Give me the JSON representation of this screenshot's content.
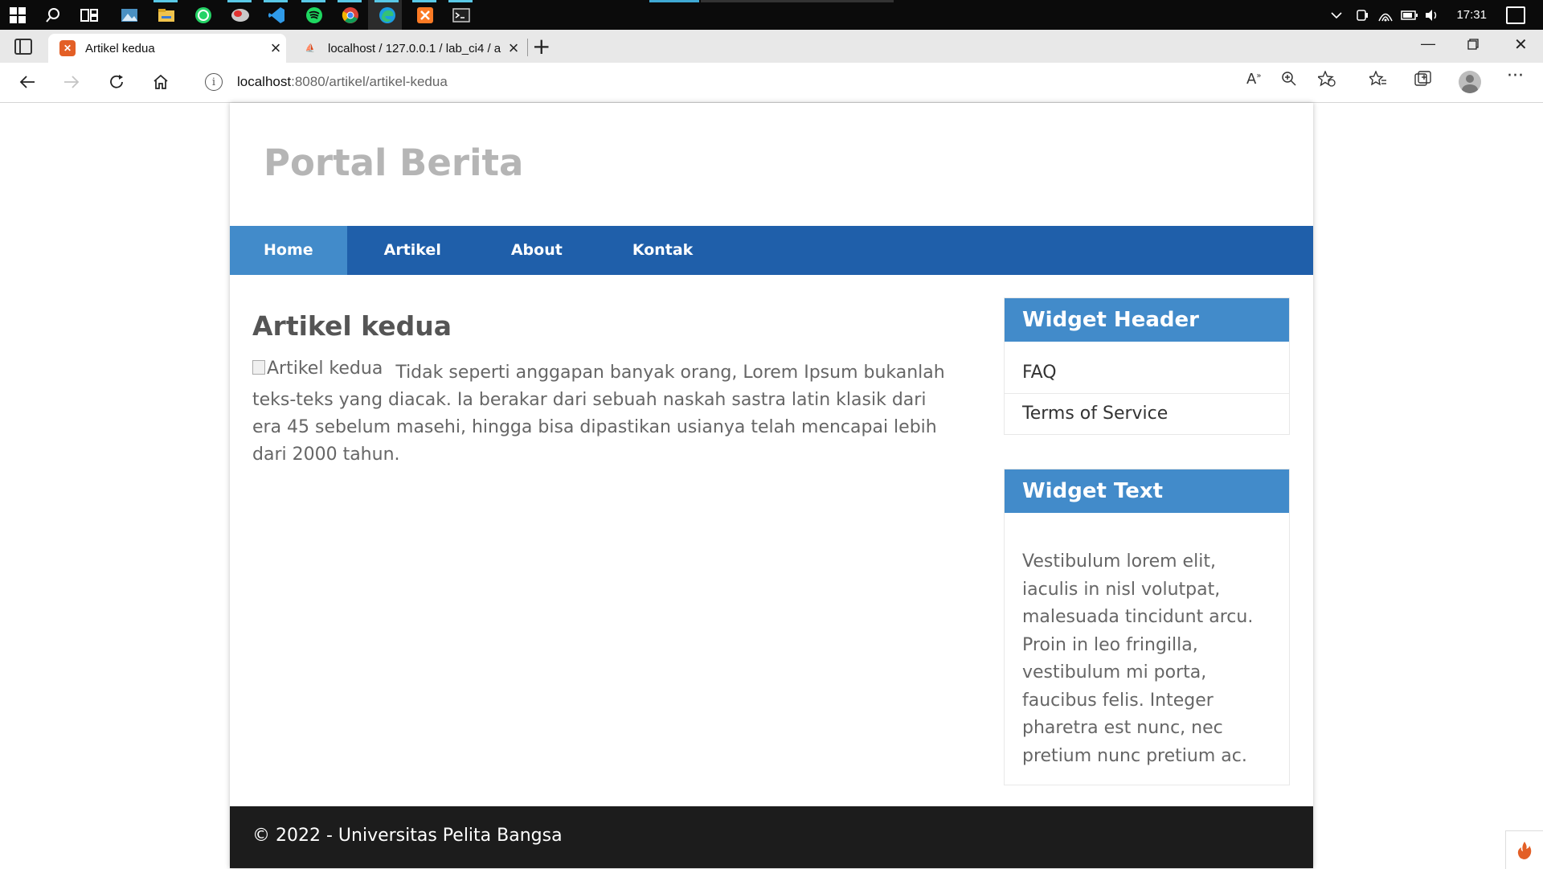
{
  "taskbar": {
    "clock": "17:31",
    "icons": [
      "windows-start-icon",
      "search-icon",
      "task-view-icon",
      "photos-icon",
      "file-explorer-icon",
      "whatsapp-icon",
      "anydesk-icon",
      "vscode-icon",
      "spotify-icon",
      "chrome-icon",
      "edge-icon",
      "xampp-icon",
      "terminal-icon"
    ]
  },
  "browser": {
    "tabs": [
      {
        "label": "Artikel kedua",
        "active": true
      },
      {
        "label": "localhost / 127.0.0.1 / lab_ci4 / a",
        "active": false
      }
    ],
    "address": {
      "host": "localhost",
      "path": ":8080/artikel/artikel-kedua"
    }
  },
  "site": {
    "title": "Portal Berita",
    "nav": [
      "Home",
      "Artikel",
      "About",
      "Kontak"
    ],
    "article": {
      "title": "Artikel kedua",
      "image_alt": "Artikel kedua",
      "body": "Tidak seperti anggapan banyak orang, Lorem Ipsum bukanlah teks-teks yang diacak. Ia berakar dari sebuah naskah sastra latin klasik dari era 45 sebelum masehi, hingga bisa dipastikan usianya telah mencapai lebih dari 2000 tahun."
    },
    "widgets": {
      "header_title": "Widget Header",
      "links": [
        "FAQ",
        "Terms of Service"
      ],
      "text_title": "Widget Text",
      "text_body": "Vestibulum lorem elit, iaculis in nisl volutpat, malesuada tincidunt arcu. Proin in leo fringilla, vestibulum mi porta, faucibus felis. Integer pharetra est nunc, nec pretium nunc pretium ac."
    },
    "footer": "© 2022 - Universitas Pelita Bangsa"
  },
  "colors": {
    "nav_bg": "#1f5faa",
    "nav_active": "#428bca",
    "widget_header": "#428bca",
    "footer_bg": "#1c1c1c",
    "title_gray": "#b5b5b5"
  }
}
